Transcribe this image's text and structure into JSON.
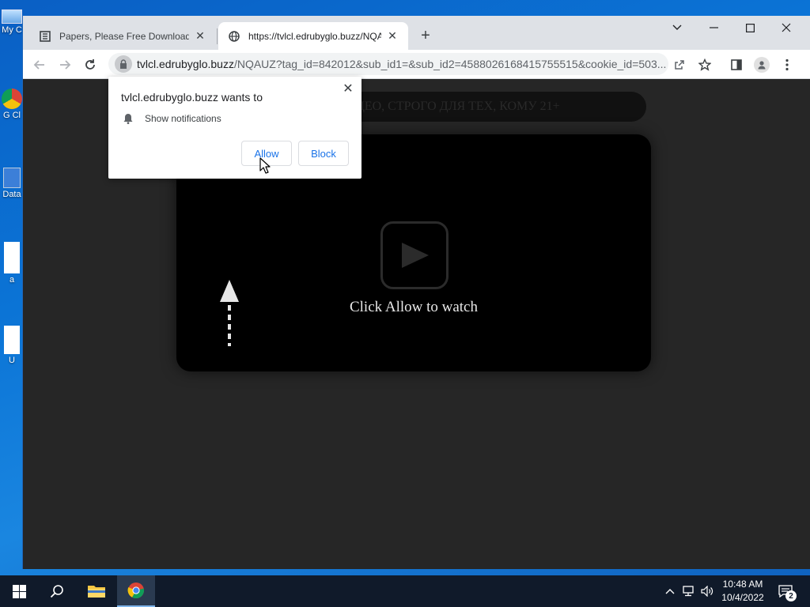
{
  "desktop": {
    "icons": [
      {
        "label": "My C"
      },
      {
        "label": "G Cl"
      },
      {
        "label": "Data"
      },
      {
        "label": "a"
      },
      {
        "label": "U"
      }
    ]
  },
  "browser": {
    "tabs": [
      {
        "title": "Papers, Please Free Download (v",
        "active": false
      },
      {
        "title": "https://tvlcl.edrubyglo.buzz/NQA",
        "active": true
      }
    ],
    "address": {
      "host": "tvlcl.edrubyglo.buzz",
      "rest": "/NQAUZ?tag_id=842012&sub_id1=&sub_id2=4588026168415755515&cookie_id=503..."
    }
  },
  "page": {
    "banner_text": "ИДЕО, СТРОГО ДЛЯ ТЕХ, КОМУ 21+",
    "watch_text": "Click Allow to watch"
  },
  "permission_prompt": {
    "title": "tvlcl.edrubyglo.buzz wants to",
    "permission": "Show notifications",
    "allow_label": "Allow",
    "block_label": "Block"
  },
  "taskbar": {
    "time": "10:48 AM",
    "date": "10/4/2022",
    "notification_count": "2"
  },
  "colors": {
    "desktop": "#0b74d6",
    "page_bg": "#262626",
    "link_blue": "#1a73e8",
    "taskbar": "#101a2a"
  }
}
